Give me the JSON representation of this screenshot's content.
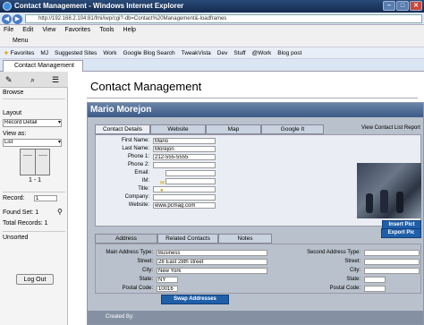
{
  "window": {
    "title": "Contact Management - Windows Internet Explorer"
  },
  "browser": {
    "url": "http://192.168.2.104:81/fmi/iwp/cgi?-db=Contact%20Management&-loadframes",
    "menu": [
      "File",
      "Edit",
      "View",
      "Favorites",
      "Tools",
      "Help"
    ],
    "cmd_label": "Menu",
    "favorites": [
      "Favorites",
      "MJ",
      "Suggested Sites",
      "Work",
      "Google Blog Search",
      "TweakVista",
      "Dev",
      "Stuff",
      "@Work",
      "Blog post"
    ],
    "tab_label": "Contact Management"
  },
  "sidebar": {
    "browse_label": "Browse",
    "layout_label": "Layout",
    "layout_value": "Record Detail",
    "viewas_label": "View as:",
    "viewas_value": "List",
    "book_label": "1 - 1",
    "record_label": "Record:",
    "record_value": "1",
    "foundset_label": "Found Set: 1",
    "total_label": "Total Records: 1",
    "sort_label": "Unsorted",
    "logout_label": "Log Out"
  },
  "app": {
    "heading": "Contact Management",
    "contact_name": "Mario Morejon",
    "tabs": [
      "Contact Details",
      "Website",
      "Map",
      "Google It"
    ],
    "view_list_link": "View Contact List Report",
    "fields": [
      {
        "label": "First Name:",
        "value": "Mario"
      },
      {
        "label": "Last Name:",
        "value": "Morejon"
      },
      {
        "label": "Phone 1:",
        "value": "212-555-5555"
      },
      {
        "label": "Phone 2:",
        "value": ""
      },
      {
        "label": "Email:",
        "value": ""
      },
      {
        "label": "IM:",
        "value": ""
      },
      {
        "label": "Title:",
        "value": ""
      },
      {
        "label": "Company:",
        "value": ""
      },
      {
        "label": "Website:",
        "value": "www.pcmag.com"
      }
    ],
    "insert_pic": "Insert Pict",
    "export_pic": "Export Pic",
    "addr_tabs": [
      "Address",
      "Related Contacts",
      "Notes"
    ],
    "main_address": {
      "type_label": "Main Address Type:",
      "type": "Business",
      "street_label": "Street:",
      "street": "28 East 28th street",
      "city_label": "City:",
      "city": "New York",
      "state_label": "State:",
      "state": "NY",
      "postal_label": "Postal Code:",
      "postal": "10016"
    },
    "second_address": {
      "type_label": "Second Address Type:",
      "street_label": "Street:",
      "city_label": "City:",
      "state_label": "State:",
      "postal_label": "Postal Code:"
    },
    "swap_label": "Swap Addresses",
    "created_by": "Created By:"
  }
}
